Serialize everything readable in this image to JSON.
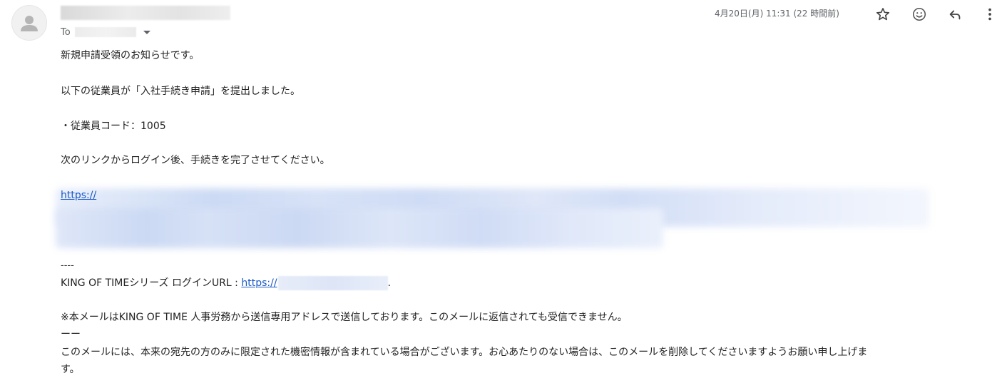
{
  "header": {
    "to_label": "To",
    "timestamp": "4月20日(月) 11:31 (22 時間前)"
  },
  "body": {
    "line1": "新規申請受領のお知らせです。",
    "line2": "以下の従業員が「入社手続き申請」を提出しました。",
    "line3": "・従業員コード：1005",
    "line4": "次のリンクからログイン後、手続きを完了させてください。",
    "link1": "https://",
    "separator": "----",
    "login_prefix": "KING OF TIMEシリーズ ログインURL : ",
    "link2": "https://",
    "link2_end": ".",
    "notice": "※本メールはKING OF TIME 人事労務から送信専用アドレスで送信しております。このメールに返信されても受信できません。",
    "dash": "ーー",
    "confidential1": "このメールには、本来の宛先の方のみに限定された機密情報が含まれている場合がございます。お心あたりのない場合は、このメールを削除してくださいますようお願い申し上げま",
    "confidential2": "す。"
  },
  "icons": [
    "person-icon",
    "chevron-down-icon",
    "star-icon",
    "emoji-icon",
    "reply-icon",
    "more-vert-icon"
  ],
  "colors": {
    "link": "#1a59c7",
    "meta_text": "#5f6368",
    "body_text": "#222222"
  }
}
